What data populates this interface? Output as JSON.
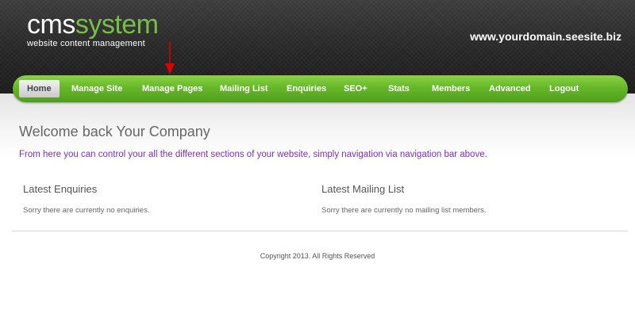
{
  "header": {
    "logo_cms": "cms",
    "logo_system": "system",
    "tagline": "website content management",
    "domain": "www.yourdomain.seesite.biz"
  },
  "annotation": {
    "icon": "arrow-down-icon",
    "color": "#e00000"
  },
  "nav": {
    "items": [
      {
        "label": "Home",
        "active": true
      },
      {
        "label": "Manage Site"
      },
      {
        "label": "Manage Pages"
      },
      {
        "label": "Mailing List"
      },
      {
        "label": "Enquiries"
      },
      {
        "label": "SEO+"
      },
      {
        "label": "Stats"
      },
      {
        "label": "Members"
      },
      {
        "label": "Advanced"
      },
      {
        "label": "Logout"
      }
    ]
  },
  "main": {
    "welcome": "Welcome back Your Company",
    "intro": "From here you can control your all the different sections of your website, simply navigation via navigation bar above.",
    "enquiries": {
      "title": "Latest Enquiries",
      "empty_text": "Sorry there are currently no enquiries."
    },
    "mailing": {
      "title": "Latest Mailing List",
      "empty_text": "Sorry there are currently no mailing list members."
    }
  },
  "footer": {
    "copyright": "Copyright 2013. All Rights Reserved"
  },
  "colors": {
    "accent_green": "#6cbf2f",
    "link_purple": "#7b2fb5",
    "header_dark": "#262626"
  }
}
